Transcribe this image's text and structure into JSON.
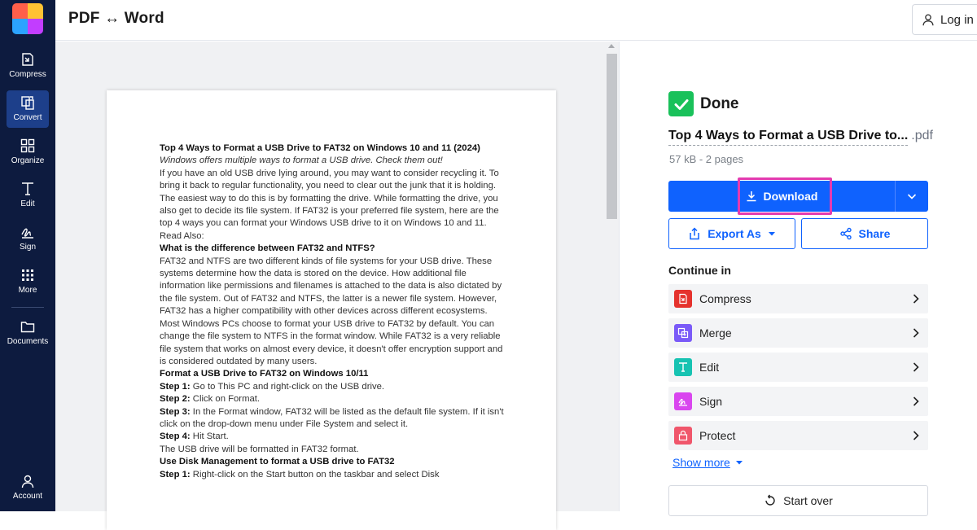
{
  "app": {
    "title": "PDF ↔ Word",
    "login_label": "Log in"
  },
  "nav": {
    "items": [
      {
        "label": "Compress",
        "icon": "compress-icon"
      },
      {
        "label": "Convert",
        "icon": "convert-icon",
        "active": true
      },
      {
        "label": "Organize",
        "icon": "organize-icon"
      },
      {
        "label": "Edit",
        "icon": "edit-icon"
      },
      {
        "label": "Sign",
        "icon": "sign-icon"
      },
      {
        "label": "More",
        "icon": "more-grid-icon"
      },
      {
        "label": "Documents",
        "icon": "folder-icon"
      },
      {
        "label": "Account",
        "icon": "account-icon"
      }
    ]
  },
  "document": {
    "title": "Top 4 Ways to Format a USB Drive to FAT32 on Windows 10 and 11 (2024)",
    "subtitle": "Windows offers multiple ways to format a USB drive. Check them out!",
    "intro": "If you have an old USB drive lying around, you may want to consider recycling it. To bring it back to regular functionality, you need to clear out the junk that it is holding. The easiest way to do this is by formatting the drive. While formatting the drive, you also get to decide its file system. If FAT32 is your preferred file system, here are the top 4 ways you can format your Windows USB drive to it on Windows 10 and 11.",
    "read_also": "Read Also:",
    "h_difference": "What is the difference between FAT32 and NTFS?",
    "p_difference": "FAT32 and NTFS are two different kinds of file systems for your USB drive. These systems determine how the data is stored on the device. How additional file information like permissions and filenames is attached to the data is also dictated by the file system. Out of FAT32 and NTFS, the latter is a newer file system. However, FAT32 has a higher compatibility with other devices across different ecosystems.",
    "p_default": "Most Windows PCs choose to format your USB drive to FAT32 by default. You can change the file system to NTFS in the format window. While FAT32 is a very reliable file system that works on almost every device, it doesn't offer encryption support and is considered outdated by many users.",
    "h_format": "Format a USB Drive to FAT32 on Windows 10/11",
    "steps": [
      {
        "label": "Step 1:",
        "text": " Go to This PC and right-click on the USB drive."
      },
      {
        "label": "Step 2:",
        "text": " Click on Format."
      },
      {
        "label": "Step 3:",
        "text": " In the Format window, FAT32 will be listed as the default file system. If it isn't click on the drop-down menu under File System and select it."
      },
      {
        "label": "Step 4:",
        "text": " Hit Start."
      }
    ],
    "p_formatted": "The USB drive will be formatted in FAT32 format.",
    "h_disk": "Use Disk Management to format a USB drive to FAT32",
    "disk_step": {
      "label": "Step 1:",
      "text": " Right-click on the Start button on the taskbar and select Disk"
    }
  },
  "result": {
    "status": "Done",
    "file_name": "Top 4 Ways to Format a USB Drive to...",
    "file_ext": ".pdf",
    "meta": "57 kB - 2 pages",
    "download_label": "Download",
    "export_label": "Export As",
    "share_label": "Share",
    "continue_label": "Continue in",
    "tools": [
      {
        "label": "Compress",
        "color": "#e5322d",
        "icon": "compress-tool-icon"
      },
      {
        "label": "Merge",
        "color": "#7a5af8",
        "icon": "merge-tool-icon"
      },
      {
        "label": "Edit",
        "color": "#17c3b2",
        "icon": "edit-tool-icon"
      },
      {
        "label": "Sign",
        "color": "#d946ef",
        "icon": "sign-tool-icon"
      },
      {
        "label": "Protect",
        "color": "#f0566b",
        "icon": "protect-tool-icon"
      }
    ],
    "show_more": "Show more",
    "start_over": "Start over"
  },
  "colors": {
    "nav_bg": "#0d1b3f",
    "accent": "#0f62fe",
    "done_green": "#19c15a",
    "highlight": "#e43bb0"
  }
}
